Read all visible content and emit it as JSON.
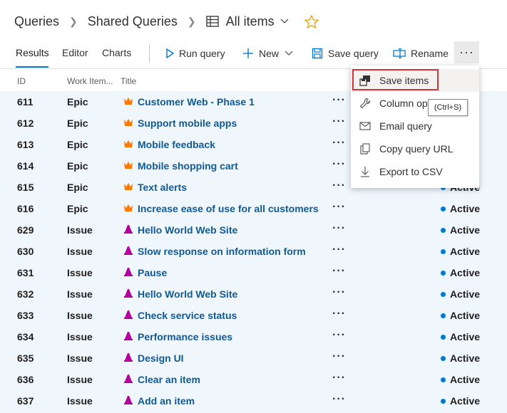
{
  "breadcrumb": {
    "root": "Queries",
    "folder": "Shared Queries",
    "current": "All items"
  },
  "tabs": [
    {
      "label": "Results",
      "active": true
    },
    {
      "label": "Editor",
      "active": false
    },
    {
      "label": "Charts",
      "active": false
    }
  ],
  "commands": {
    "run_query": "Run query",
    "new": "New",
    "save_query": "Save query",
    "rename": "Rename",
    "more": "···"
  },
  "columns": {
    "id": "ID",
    "work_item_type": "Work Item...",
    "title": "Title"
  },
  "rows": [
    {
      "id": "611",
      "type": "Epic",
      "title": "Customer Web - Phase 1",
      "icon": "crown-icon",
      "state": ""
    },
    {
      "id": "612",
      "type": "Epic",
      "title": "Support mobile apps",
      "icon": "crown-icon",
      "state": ""
    },
    {
      "id": "613",
      "type": "Epic",
      "title": "Mobile feedback",
      "icon": "crown-icon",
      "state": ""
    },
    {
      "id": "614",
      "type": "Epic",
      "title": "Mobile shopping cart",
      "icon": "crown-icon",
      "state": ""
    },
    {
      "id": "615",
      "type": "Epic",
      "title": "Text alerts",
      "icon": "crown-icon",
      "state": "Active"
    },
    {
      "id": "616",
      "type": "Epic",
      "title": "Increase ease of use for all customers",
      "icon": "crown-icon",
      "state": "Active"
    },
    {
      "id": "629",
      "type": "Issue",
      "title": "Hello World Web Site",
      "icon": "issue-icon",
      "state": "Active"
    },
    {
      "id": "630",
      "type": "Issue",
      "title": "Slow response on information form",
      "icon": "issue-icon",
      "state": "Active"
    },
    {
      "id": "631",
      "type": "Issue",
      "title": "Pause",
      "icon": "issue-icon",
      "state": "Active"
    },
    {
      "id": "632",
      "type": "Issue",
      "title": "Hello World Web Site",
      "icon": "issue-icon",
      "state": "Active"
    },
    {
      "id": "633",
      "type": "Issue",
      "title": "Check service status",
      "icon": "issue-icon",
      "state": "Active"
    },
    {
      "id": "634",
      "type": "Issue",
      "title": "Performance issues",
      "icon": "issue-icon",
      "state": "Active"
    },
    {
      "id": "635",
      "type": "Issue",
      "title": "Design UI",
      "icon": "issue-icon",
      "state": "Active"
    },
    {
      "id": "636",
      "type": "Issue",
      "title": "Clear an item",
      "icon": "issue-icon",
      "state": "Active"
    },
    {
      "id": "637",
      "type": "Issue",
      "title": "Add an item",
      "icon": "issue-icon",
      "state": "Active"
    }
  ],
  "row_actions": "···",
  "menu": {
    "items": [
      {
        "label": "Save items",
        "icon": "save-items-icon"
      },
      {
        "label": "Column op",
        "icon": "wrench-icon"
      },
      {
        "label": "Email query",
        "icon": "mail-icon"
      },
      {
        "label": "Copy query URL",
        "icon": "copy-icon"
      },
      {
        "label": "Export to CSV",
        "icon": "download-icon"
      }
    ],
    "tooltip": "(Ctrl+S)"
  },
  "colors": {
    "accent": "#0078d4",
    "link": "#0f5a96",
    "epic": "#ff7b00",
    "issue": "#b4009e",
    "highlight": "#d13438",
    "row_bg": "#eff6fc"
  }
}
